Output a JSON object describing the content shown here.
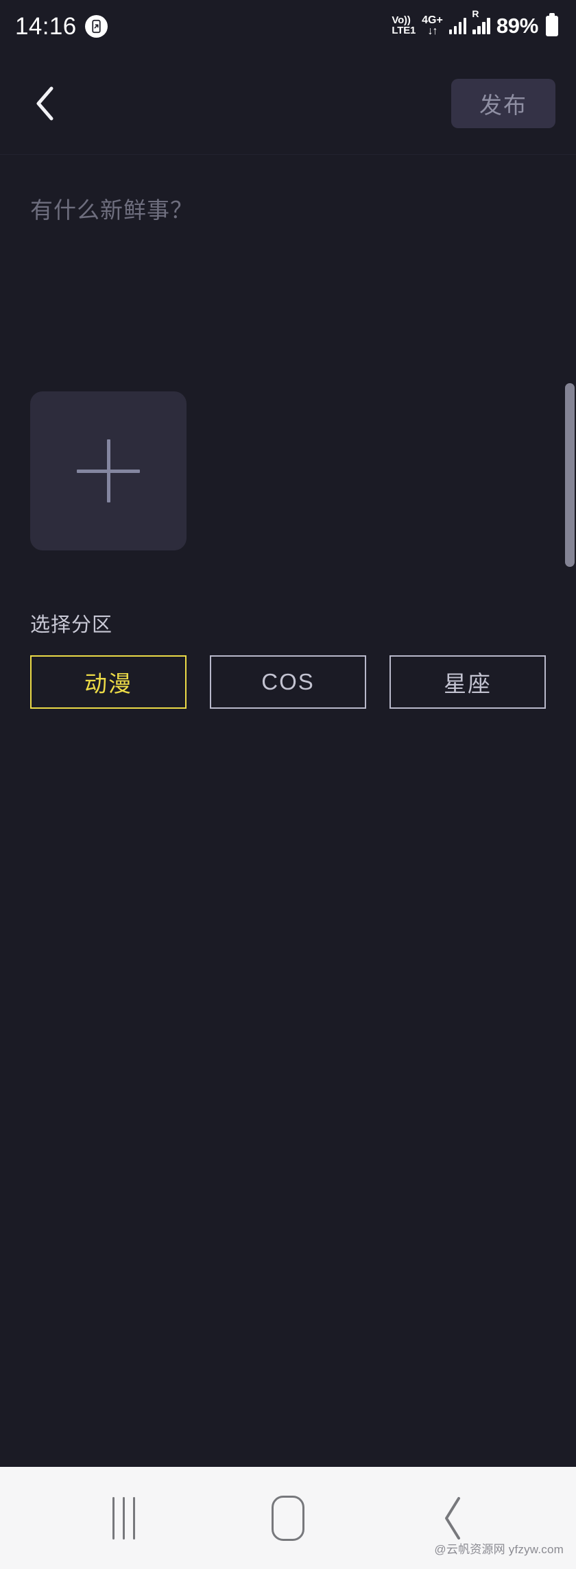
{
  "statusbar": {
    "time": "14:16",
    "app_icon": "screen-record-icon",
    "volte_line1": "Vo))",
    "volte_line2": "LTE1",
    "network_label": "4G+",
    "network_arrows": "↓↑",
    "roaming_label": "R",
    "battery_percent": "89%",
    "battery_icon": "battery-icon"
  },
  "appbar": {
    "back_icon": "chevron-left-icon",
    "publish_label": "发布"
  },
  "compose": {
    "placeholder": "有什么新鲜事？",
    "value": "",
    "add_media_icon": "plus-icon"
  },
  "category": {
    "title": "选择分区",
    "chips": [
      {
        "label": "动漫",
        "selected": true
      },
      {
        "label": "COS",
        "selected": false
      },
      {
        "label": "星座",
        "selected": false
      }
    ]
  },
  "navbar": {
    "recents_icon": "recents-icon",
    "home_icon": "home-icon",
    "back_icon": "back-chevron-icon",
    "watermark": "@云帆资源网 yfzyw.com"
  },
  "colors": {
    "background": "#1b1b25",
    "surface": "#2d2c3c",
    "accent_yellow": "#ecdb47",
    "muted_text": "#6e6e7e",
    "navbar_bg": "#f6f6f7"
  }
}
